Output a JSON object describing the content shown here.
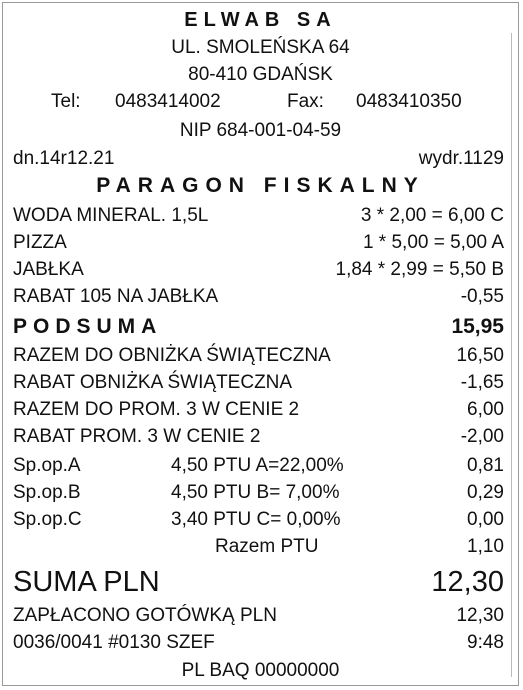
{
  "header": {
    "company": "ELWAB SA",
    "street": "UL. SMOLEŃSKA 64",
    "city": "80-410 GDAŃSK",
    "tel_label": "Tel:",
    "tel_value": "0483414002",
    "fax_label": "Fax:",
    "fax_value": "0483410350",
    "nip": "NIP  684-001-04-59"
  },
  "meta": {
    "date": "dn.14r12.21",
    "printout": "wydr.1129"
  },
  "title": "PARAGON FISKALNY",
  "items": [
    {
      "name": "WODA MINERAL. 1,5L",
      "calc": "3 * 2,00 = 6,00 C"
    },
    {
      "name": "PIZZA",
      "calc": "1 * 5,00 = 5,00 A"
    },
    {
      "name": "JABŁKA",
      "calc": "1,84 * 2,99 = 5,50 B"
    },
    {
      "name": "RABAT 105 NA JABŁKA",
      "calc": "-0,55"
    }
  ],
  "subtotal": {
    "label": "PODSUMA",
    "value": "15,95"
  },
  "adjustments": [
    {
      "name": "RAZEM DO OBNIŻKA ŚWIĄTECZNA",
      "value": "16,50"
    },
    {
      "name": "RABAT OBNIŻKA ŚWIĄTECZNA",
      "value": "-1,65"
    },
    {
      "name": "RAZEM DO PROM. 3 W CENIE 2",
      "value": "6,00"
    },
    {
      "name": "RABAT PROM. 3 W CENIE 2",
      "value": "-2,00"
    }
  ],
  "tax_rows": [
    {
      "label": "Sp.op.A",
      "detail": "4,50 PTU A=22,00%",
      "value": "0,81"
    },
    {
      "label": "Sp.op.B",
      "detail": "4,50 PTU B=  7,00%",
      "value": "0,29"
    },
    {
      "label": "Sp.op.C",
      "detail": "3,40 PTU C=  0,00%",
      "value": "0,00"
    }
  ],
  "tax_total": {
    "label": "Razem PTU",
    "value": "1,10"
  },
  "total": {
    "label": "SUMA PLN",
    "value": "12,30"
  },
  "payment": {
    "label": "ZAPŁACONO GOTÓWKĄ PLN",
    "value": "12,30"
  },
  "footer": {
    "code": "0036/0041 #0130 SZEF",
    "time": "9:48",
    "device": "PL BAQ 00000000"
  }
}
